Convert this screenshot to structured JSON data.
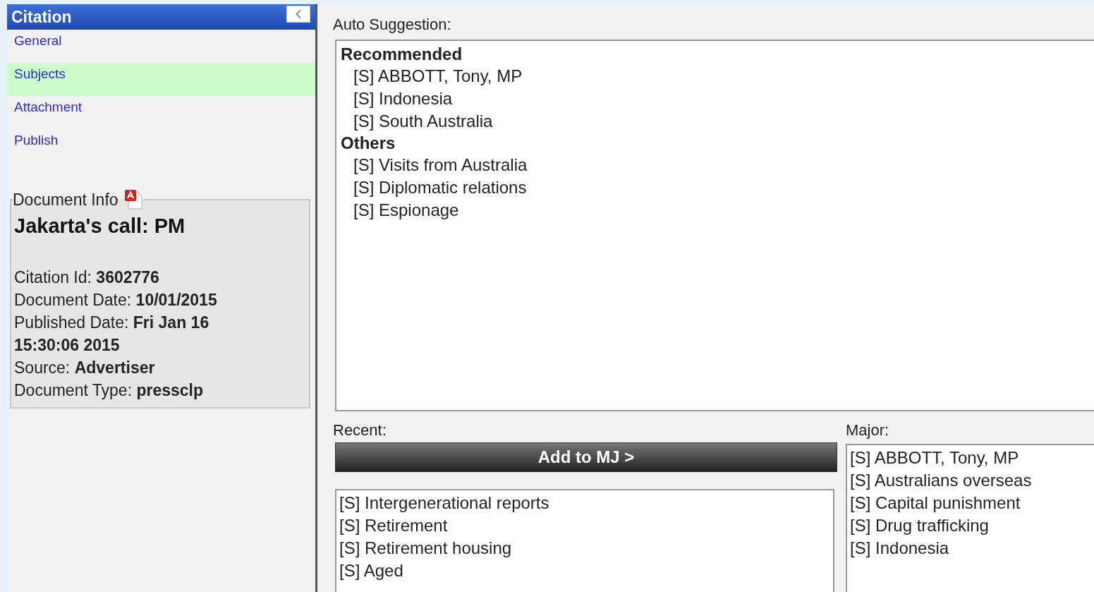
{
  "sidebar": {
    "title": "Citation",
    "items": [
      {
        "label": "General",
        "selected": false
      },
      {
        "label": "Subjects",
        "selected": true
      },
      {
        "label": "Attachment",
        "selected": false
      },
      {
        "label": "Publish",
        "selected": false
      }
    ]
  },
  "document_info": {
    "legend": "Document Info",
    "title": "Jakarta's call: PM",
    "fields": [
      "Citation Id: **3602776**",
      "Document Date: **10/01/2015**",
      "Published Date: **Fri Jan 16 15:30:06 2015**",
      "Source: **Advertiser**",
      "Document Type: **pressclp**"
    ]
  },
  "auto_suggestion": {
    "label": "Auto Suggestion:",
    "groups": [
      {
        "heading": "Recommended",
        "items": [
          "[S] ABBOTT, Tony, MP",
          "[S] Indonesia",
          "[S] South Australia"
        ]
      },
      {
        "heading": "Others",
        "items": [
          "[S] Visits from Australia",
          "[S] Diplomatic relations",
          "[S] Espionage"
        ]
      }
    ]
  },
  "recent": {
    "label": "Recent:",
    "button": "Add to MJ >",
    "items": [
      "[S] Intergenerational reports",
      "[S] Retirement",
      "[S] Retirement housing",
      "[S] Aged"
    ]
  },
  "major": {
    "label": "Major:",
    "items": [
      "[S] ABBOTT, Tony, MP",
      "[S] Australians overseas",
      "[S] Capital punishment",
      "[S] Drug trafficking",
      "[S] Indonesia"
    ]
  }
}
